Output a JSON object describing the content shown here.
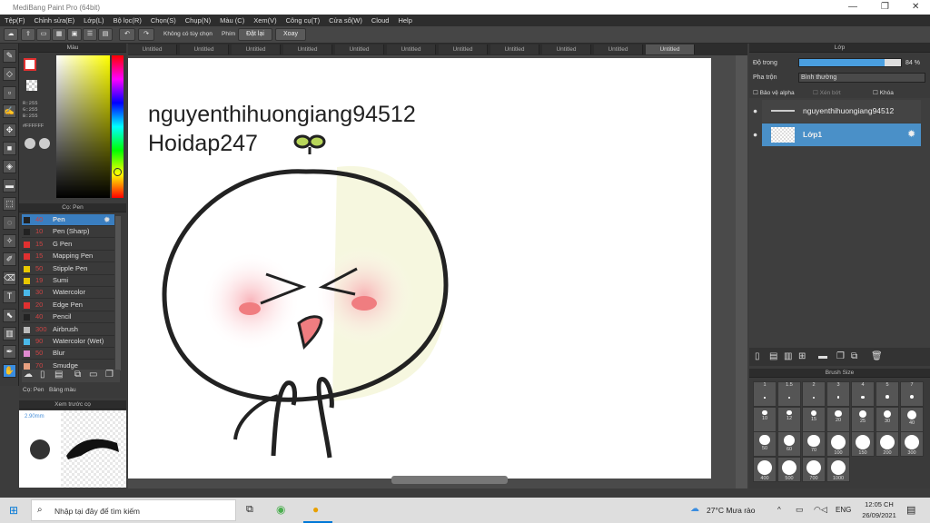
{
  "window": {
    "title": "MediBang Paint Pro (64bit)"
  },
  "menu": [
    "Tệp(F)",
    "Chỉnh sửa(E)",
    "Lớp(L)",
    "Bộ lọc(R)",
    "Chọn(S)",
    "Chụp(N)",
    "Màu (C)",
    "Xem(V)",
    "Công cụ(T)",
    "Cửa sổ(W)",
    "Cloud",
    "Help"
  ],
  "toolbar": {
    "no_option": "Không có tùy chọn",
    "key_label": "Phím",
    "reset_label": "Đặt lại",
    "rotate_label": "Xoay"
  },
  "color_panel": {
    "title": "Màu",
    "rgb": "R:255\nG:255\nB:255",
    "hex": "#FFFFFF"
  },
  "pen_panel": {
    "title": "Cọ: Pen",
    "items": [
      {
        "size": "40",
        "name": "Pen",
        "color": "#222"
      },
      {
        "size": "10",
        "name": "Pen (Sharp)",
        "color": "#222"
      },
      {
        "size": "15",
        "name": "G Pen",
        "color": "#e03030"
      },
      {
        "size": "15",
        "name": "Mapping Pen",
        "color": "#e03030"
      },
      {
        "size": "50",
        "name": "Stipple Pen",
        "color": "#e8c800"
      },
      {
        "size": "19",
        "name": "Sumi",
        "color": "#e8c800"
      },
      {
        "size": "30",
        "name": "Watercolor",
        "color": "#4ab8e8"
      },
      {
        "size": "20",
        "name": "Edge Pen",
        "color": "#e03030"
      },
      {
        "size": "40",
        "name": "Pencil",
        "color": "#222"
      },
      {
        "size": "300",
        "name": "Airbrush",
        "color": "#bbb"
      },
      {
        "size": "90",
        "name": "Watercolor (Wet)",
        "color": "#4ab8e8"
      },
      {
        "size": "50",
        "name": "Blur",
        "color": "#e08ad0"
      },
      {
        "size": "70",
        "name": "Smudge",
        "color": "#e8a080"
      }
    ],
    "tab1": "Cọ: Pen",
    "tab2": "Bảng màu"
  },
  "preview": {
    "title": "Xem trước cọ",
    "size": "2.90mm"
  },
  "tabs": [
    "Untitled",
    "Untitled",
    "Untitled",
    "Untitled",
    "Untitled",
    "Untitled",
    "Untitled",
    "Untitled",
    "Untitled",
    "Untitled",
    "Untitled"
  ],
  "canvas": {
    "line1": "nguyenthihuongiang94512",
    "line2": "Hoidap247"
  },
  "layer_panel": {
    "title": "Lớp",
    "opacity_label": "Độ trong",
    "opacity_value": "84 %",
    "opacity": 0.84,
    "blend_label": "Pha trộn",
    "blend_value": "Bình thường",
    "protect_alpha": "Bảo vệ alpha",
    "clipping": "Xén bớt",
    "lock": "Khóa",
    "layers": [
      {
        "name": "nguyenthihuongiang94512"
      },
      {
        "name": "Lớp1"
      }
    ]
  },
  "brush_size": {
    "title": "Brush Size",
    "sizes": [
      "1",
      "1.5",
      "2",
      "3",
      "4",
      "5",
      "7",
      "10",
      "12",
      "15",
      "20",
      "25",
      "30",
      "40",
      "50",
      "60",
      "70",
      "100",
      "150",
      "200",
      "300",
      "400",
      "500",
      "700",
      "1000"
    ]
  },
  "taskbar": {
    "search": "Nhập tại đây để tìm kiếm",
    "weather": "27°C Mưa rào",
    "lang": "ENG",
    "time": "12:05 CH",
    "date": "26/09/2021"
  }
}
